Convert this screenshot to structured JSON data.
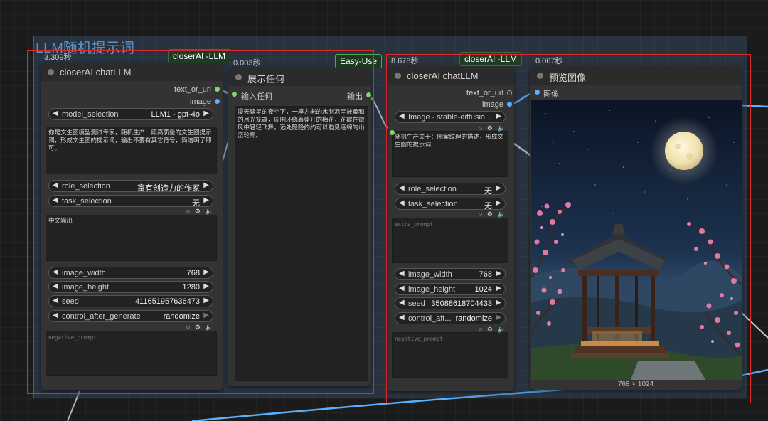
{
  "group": {
    "title": "LLM随机提示词"
  },
  "node1": {
    "timing": "3.309秒",
    "tag": "closerAI -LLM",
    "title": "closerAI chatLLM",
    "outputs": [
      "text_or_url",
      "image"
    ],
    "model_selection": {
      "label": "model_selection",
      "value": "LLM1 - gpt-4o"
    },
    "prompt_text": "你是文生图模型测试专家，随机生产一段高质量的文生图提示词，形成文生图的提示词，输出不要有其它符号，简洁明了即可。",
    "role_selection": {
      "label": "role_selection",
      "value": "富有创造力的作家"
    },
    "task_selection": {
      "label": "task_selection",
      "value": "无"
    },
    "extra_prompt": "中文输出",
    "image_width": {
      "label": "image_width",
      "value": "768"
    },
    "image_height": {
      "label": "image_height",
      "value": "1280"
    },
    "seed": {
      "label": "seed",
      "value": "411651957636473"
    },
    "control_after_generate": {
      "label": "control_after_generate",
      "value": "randomize"
    },
    "negative_prompt_placeholder": "negative_prompt"
  },
  "node2": {
    "timing": "0.003秒",
    "tag": "Easy-Use",
    "title": "展示任何",
    "input_label": "输入任何",
    "output_label": "输出",
    "text": "漫天繁星的夜空下，一座古老的木制凉亭被柔和的月光笼罩，周围环绕着盛开的梅花，花瓣在微风中轻轻飞舞，远处隐隐约约可以看见连绵的山峦轮廓。"
  },
  "node3": {
    "timing": "8.678秒",
    "tag": "closerAI -LLM",
    "title": "closerAI chatLLM",
    "outputs": [
      "text_or_url",
      "image"
    ],
    "model_selection": {
      "value": "Image - stable-diffusio..."
    },
    "prompt_text": "随机生产关于：图案纹理的描述，形成文生图的提示词",
    "role_selection": {
      "label": "role_selection",
      "value": "无"
    },
    "task_selection": {
      "label": "task_selection",
      "value": "无"
    },
    "extra_prompt_placeholder": "extra_prompt",
    "image_width": {
      "label": "image_width",
      "value": "768"
    },
    "image_height": {
      "label": "image_height",
      "value": "1024"
    },
    "seed": {
      "label": "seed",
      "value": "35088618704433"
    },
    "control_after_generate": {
      "label": "control_aft...",
      "value": "randomize"
    },
    "negative_prompt_placeholder": "negative_prompt"
  },
  "node4": {
    "timing": "0.067秒",
    "title": "预览图像",
    "input_label": "图像",
    "footer": "768 × 1024"
  },
  "tools_glyphs": "○ ⚙ 🔈",
  "colors": {
    "group": "#4a6e96",
    "link_blue": "#5ab0ff",
    "link_green": "#7fd86b",
    "red_frame": "#e12828"
  }
}
